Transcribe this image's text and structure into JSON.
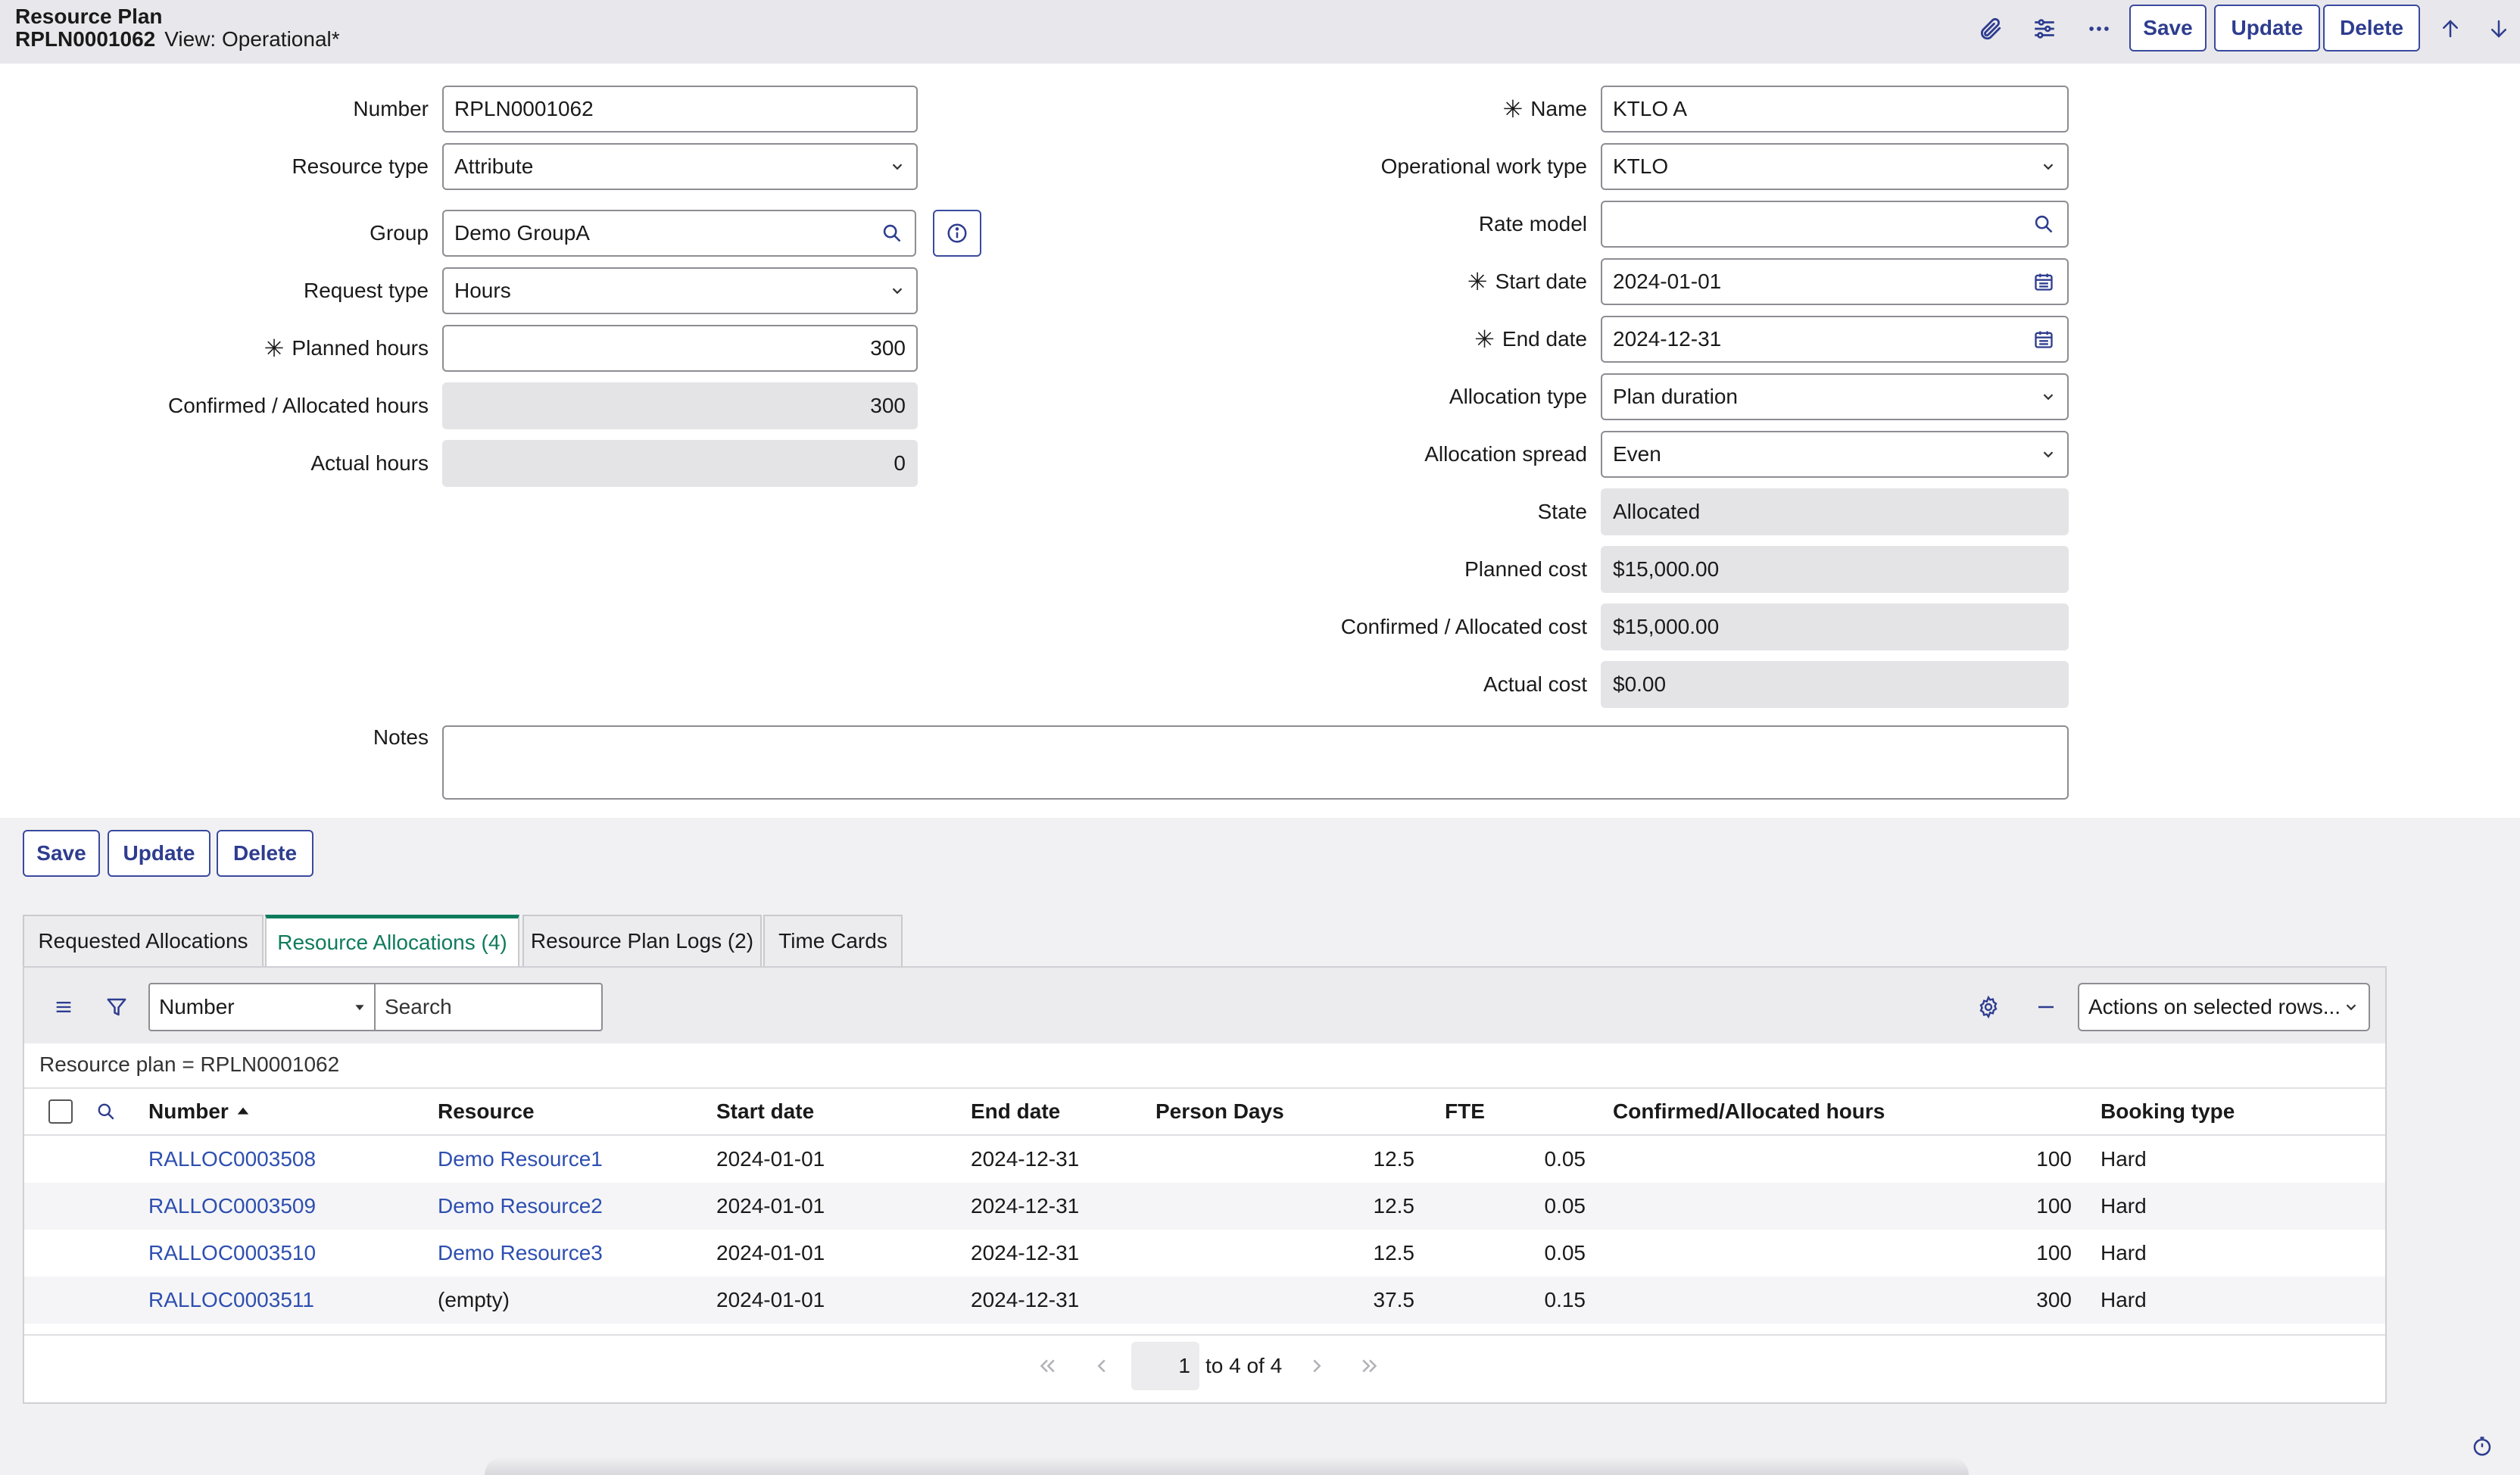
{
  "header": {
    "title": "Resource Plan",
    "record_number": "RPLN0001062",
    "view": "View: Operational*",
    "save_label": "Save",
    "update_label": "Update",
    "delete_label": "Delete"
  },
  "form": {
    "left": {
      "number_label": "Number",
      "number_value": "RPLN0001062",
      "resource_type_label": "Resource type",
      "resource_type_value": "Attribute",
      "group_label": "Group",
      "group_value": "Demo GroupA",
      "request_type_label": "Request type",
      "request_type_value": "Hours",
      "planned_hours_label": "Planned hours",
      "planned_hours_value": "300",
      "confirmed_hours_label": "Confirmed / Allocated hours",
      "confirmed_hours_value": "300",
      "actual_hours_label": "Actual hours",
      "actual_hours_value": "0"
    },
    "right": {
      "name_label": "Name",
      "name_value": "KTLO A",
      "op_work_type_label": "Operational work type",
      "op_work_type_value": "KTLO",
      "rate_model_label": "Rate model",
      "rate_model_value": "",
      "start_date_label": "Start date",
      "start_date_value": "2024-01-01",
      "end_date_label": "End date",
      "end_date_value": "2024-12-31",
      "allocation_type_label": "Allocation type",
      "allocation_type_value": "Plan duration",
      "allocation_spread_label": "Allocation spread",
      "allocation_spread_value": "Even",
      "state_label": "State",
      "state_value": "Allocated",
      "planned_cost_label": "Planned cost",
      "planned_cost_value": "$15,000.00",
      "confirmed_cost_label": "Confirmed / Allocated cost",
      "confirmed_cost_value": "$15,000.00",
      "actual_cost_label": "Actual cost",
      "actual_cost_value": "$0.00"
    },
    "notes_label": "Notes",
    "notes_value": "",
    "save_label": "Save",
    "update_label": "Update",
    "delete_label": "Delete"
  },
  "tabs": [
    {
      "label": "Requested Allocations"
    },
    {
      "label": "Resource Allocations (4)"
    },
    {
      "label": "Resource Plan Logs (2)"
    },
    {
      "label": "Time Cards"
    }
  ],
  "list": {
    "search_field": "Number",
    "search_placeholder": "Search",
    "actions_label": "Actions on selected rows...",
    "breadcrumb": "Resource plan = RPLN0001062",
    "columns": [
      "Number",
      "Resource",
      "Start date",
      "End date",
      "Person Days",
      "FTE",
      "Confirmed/Allocated hours",
      "Booking type"
    ],
    "rows": [
      [
        "RALLOC0003508",
        "Demo Resource1",
        "2024-01-01",
        "2024-12-31",
        "12.5",
        "0.05",
        "100",
        "Hard"
      ],
      [
        "RALLOC0003509",
        "Demo Resource2",
        "2024-01-01",
        "2024-12-31",
        "12.5",
        "0.05",
        "100",
        "Hard"
      ],
      [
        "RALLOC0003510",
        "Demo Resource3",
        "2024-01-01",
        "2024-12-31",
        "12.5",
        "0.05",
        "100",
        "Hard"
      ],
      [
        "RALLOC0003511",
        "(empty)",
        "2024-01-01",
        "2024-12-31",
        "37.5",
        "0.15",
        "300",
        "Hard"
      ]
    ],
    "pager_page": "1",
    "pager_text": "to 4 of 4"
  },
  "colors": {
    "accent": "#2e3d8f",
    "tab_active": "#0f7b5d",
    "link": "#2e4fb0"
  }
}
